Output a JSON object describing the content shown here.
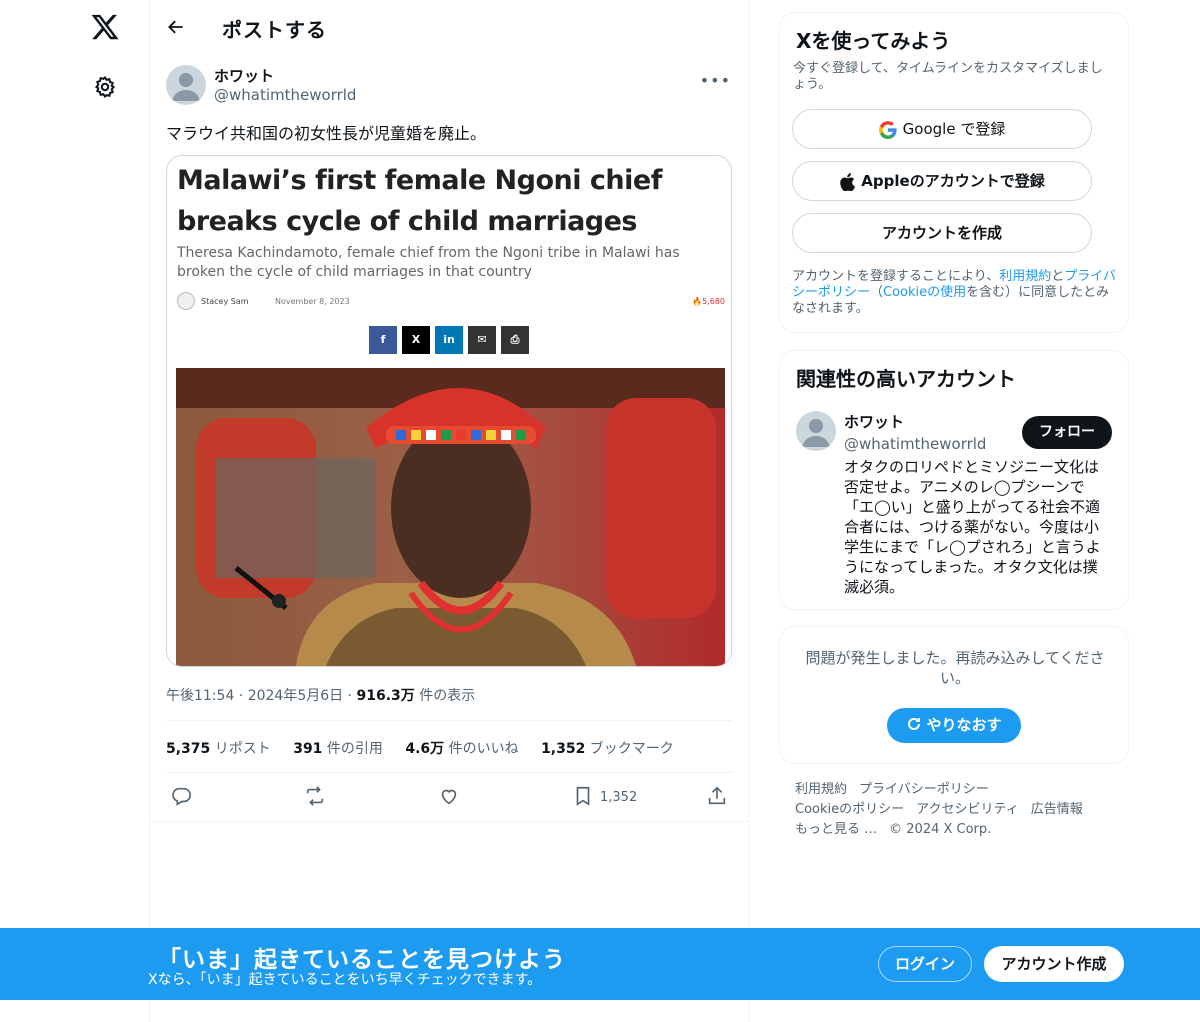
{
  "topbar": {
    "title": "ポストする"
  },
  "post": {
    "author_name": "ホワット",
    "author_handle": "@whatimtheworrld",
    "more_label": "•••",
    "text": "マラウイ共和国の初女性長が児童婚を廃止。",
    "card": {
      "headline": "Malawi’s first female Ngoni chief breaks cycle of child marriages",
      "subtitle": "Theresa Kachindamoto, female chief from the Ngoni tribe in Malawi has broken the cycle of child marriages in that country",
      "author": "Stacey Sam",
      "date": "November 8, 2023",
      "views": "5,680",
      "share_buttons": [
        {
          "icon": "facebook-icon",
          "glyph": "f",
          "color": "#3b5998"
        },
        {
          "icon": "x-icon",
          "glyph": "X",
          "color": "#000000"
        },
        {
          "icon": "linkedin-icon",
          "glyph": "in",
          "color": "#0077b5"
        },
        {
          "icon": "email-icon",
          "glyph": "✉",
          "color": "#333333"
        },
        {
          "icon": "print-icon",
          "glyph": "⎙",
          "color": "#333333"
        }
      ]
    },
    "timestamp": "午後11:54 · 2024年5月6日 · ",
    "views_count": "916.3万",
    "views_label": " 件の表示",
    "stats": {
      "reposts_count": "5,375",
      "reposts_label": " リポスト",
      "quotes_count": "391",
      "quotes_label": " 件の引用",
      "likes_count": "4.6万",
      "likes_label": " 件のいいね",
      "bookmarks_count": "1,352",
      "bookmarks_label": " ブックマーク"
    },
    "actions": {
      "bookmark_count": "1,352"
    }
  },
  "signup_panel": {
    "title": "Xを使ってみよう",
    "subtitle": "今すぐ登録して、タイムラインをカスタマイズしましょう。",
    "google_label": "Google で登録",
    "apple_label": "Appleのアカウントで登録",
    "create_label": "アカウントを作成",
    "terms_prefix": "アカウントを登録することにより、",
    "terms_link": "利用規約",
    "terms_and": "と",
    "privacy_link": "プライバシーポリシー",
    "terms_paren_open": "（",
    "cookie_link": "Cookieの使用",
    "terms_suffix": "を含む）に同意したとみなされます。"
  },
  "related_panel": {
    "title": "関連性の高いアカウント",
    "name": "ホワット",
    "handle": "@whatimtheworrld",
    "follow_label": "フォロー",
    "bio": "オタクのロリペドとミソジニー文化は否定せよ。アニメのレ◯プシーンで「エ◯い」と盛り上がってる社会不適合者には、つける薬がない。今度は小学生にまで「レ◯プされろ」と言うようになってしまった。オタク文化は撲滅必須。"
  },
  "error_panel": {
    "text": "問題が発生しました。再読み込みしてください。",
    "retry_label": "やりなおす"
  },
  "footer": {
    "links": [
      "利用規約",
      "プライバシーポリシー",
      "Cookieのポリシー",
      "アクセシビリティ",
      "広告情報",
      "もっと見る …",
      "© 2024 X Corp."
    ]
  },
  "banner": {
    "title": "「いま」起きていることを見つけよう",
    "subtitle": "Xなら、「いま」起きていることをいち早くチェックできます。",
    "login_label": "ログイン",
    "signup_label": "アカウント作成"
  },
  "colors": {
    "accent": "#1d9bf0",
    "text": "#0f1419",
    "muted": "#536471"
  }
}
